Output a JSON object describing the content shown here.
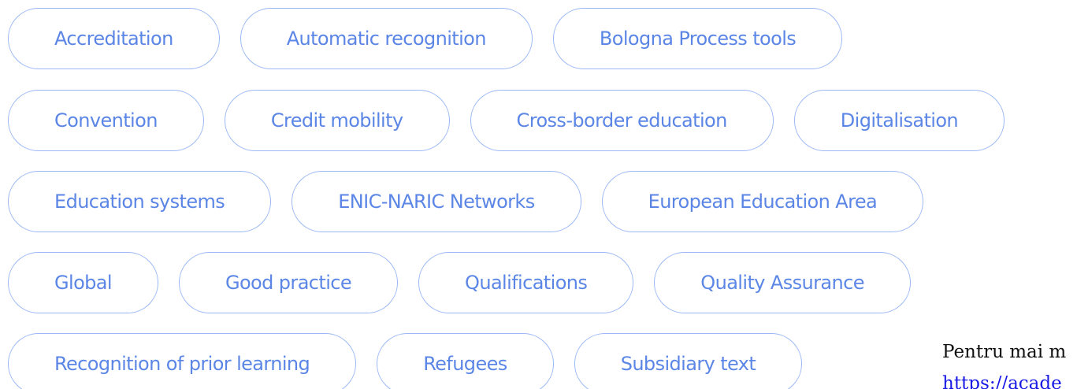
{
  "tags": {
    "row1": [
      "Accreditation",
      "Automatic recognition",
      "Bologna Process tools"
    ],
    "row2": [
      "Convention",
      "Credit mobility",
      "Cross-border education",
      "Digitalisation"
    ],
    "row3": [
      "Education systems",
      "ENIC-NARIC Networks",
      "European Education Area"
    ],
    "row4": [
      "Global",
      "Good practice",
      "Qualifications",
      "Quality Assurance"
    ],
    "row5": [
      "Recognition of prior learning",
      "Refugees",
      "Subsidiary text"
    ]
  },
  "side_note": {
    "text": "Pentru mai m",
    "link": "https://acade"
  },
  "colors": {
    "tag_text": "#5b86e6",
    "tag_border": "#9bb8f5",
    "link": "#1a1ae6"
  }
}
